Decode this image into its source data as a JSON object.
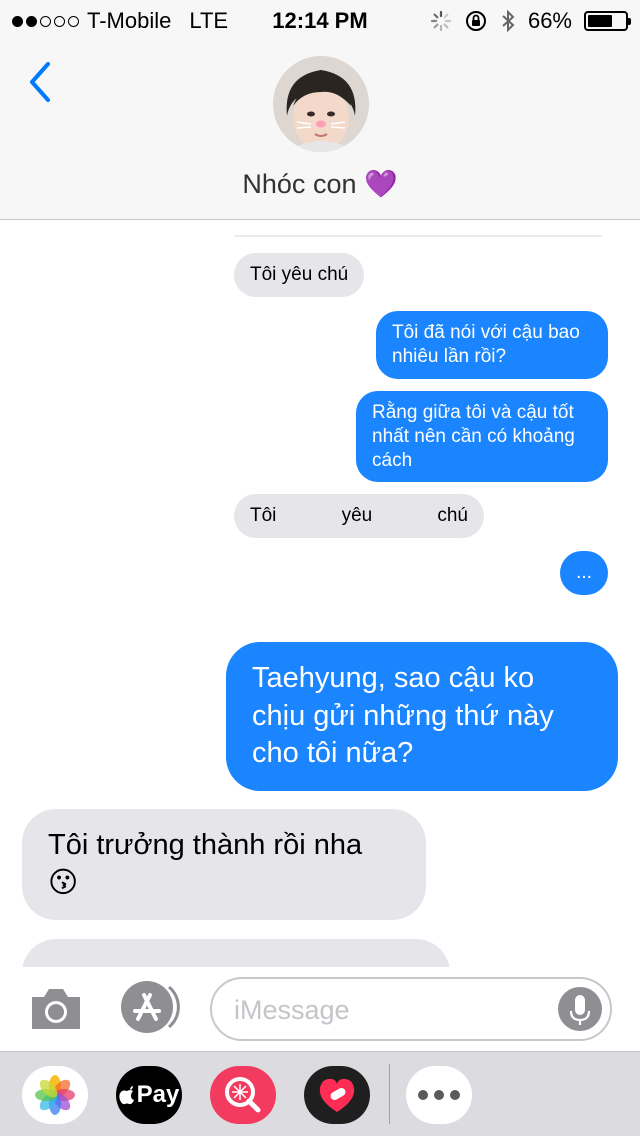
{
  "status_bar": {
    "carrier": "T-Mobile",
    "network": "LTE",
    "time": "12:14 PM",
    "battery_text": "66%",
    "battery_level": 0.66,
    "signal_bars_filled": 2,
    "signal_bars_total": 5
  },
  "header": {
    "contact_name": "Nhóc con 💜",
    "back_icon": "chevron-left-icon"
  },
  "messages": [
    {
      "side": "received",
      "text": "Tôi yêu chú"
    },
    {
      "side": "sent",
      "text": "Tôi đã nói với cậu bao nhiêu lần rồi?"
    },
    {
      "side": "sent",
      "text": "Rằng giữa tôi và cậu tốt nhất nên cần có khoảng cách"
    },
    {
      "side": "received",
      "text_parts": [
        "Tôi",
        "yêu",
        "chú"
      ]
    },
    {
      "side": "sent",
      "text": "..."
    },
    {
      "side": "sent",
      "text": "Taehyung, sao cậu ko chịu gửi những thứ này cho tôi nữa?"
    },
    {
      "side": "received",
      "text": "Tôi trưởng thành rồi nha 😗"
    }
  ],
  "input": {
    "placeholder": "iMessage"
  },
  "app_drawer": {
    "apple_pay_label": "Pay",
    "icons": [
      "photos-icon",
      "apple-pay-icon",
      "image-search-icon",
      "heart-app-icon",
      "more-apps-icon"
    ]
  },
  "colors": {
    "sent_bubble": "#1a85ff",
    "received_bubble": "#e5e5ea",
    "accent": "#007aff"
  }
}
